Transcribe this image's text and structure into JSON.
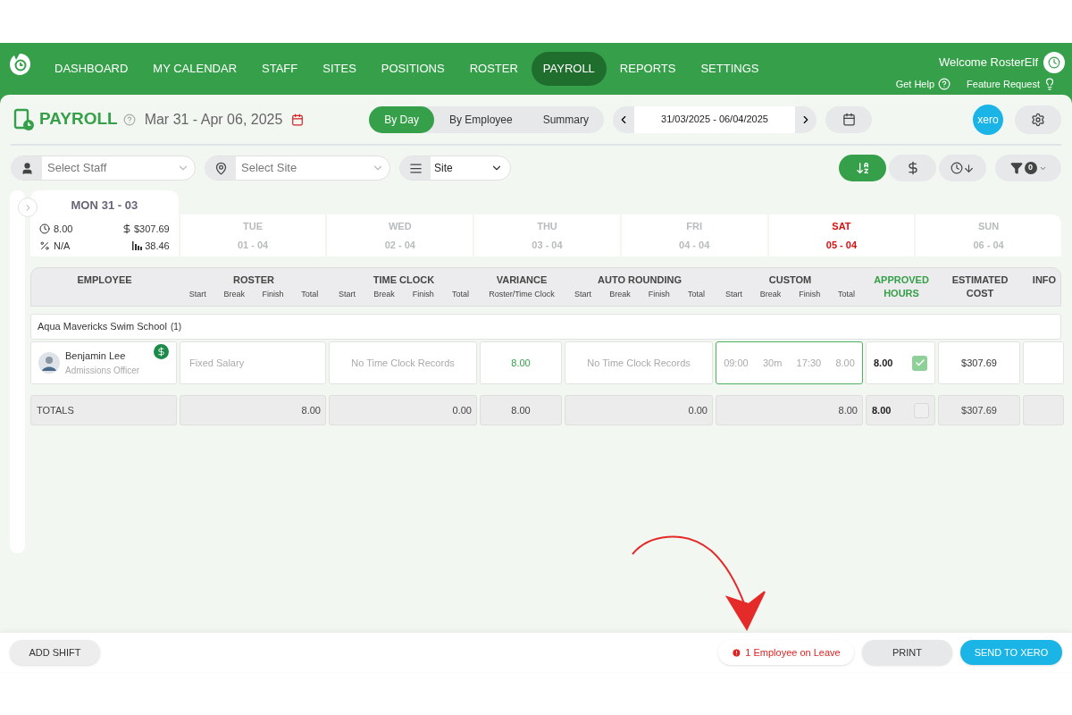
{
  "nav": {
    "items": [
      {
        "label": "DASHBOARD",
        "selected": false
      },
      {
        "label": "MY CALENDAR",
        "selected": false
      },
      {
        "label": "STAFF",
        "selected": false
      },
      {
        "label": "SITES",
        "selected": false
      },
      {
        "label": "POSITIONS",
        "selected": false
      },
      {
        "label": "ROSTER",
        "selected": false
      },
      {
        "label": "PAYROLL",
        "selected": true
      },
      {
        "label": "REPORTS",
        "selected": false
      },
      {
        "label": "SETTINGS",
        "selected": false
      }
    ],
    "welcome": "Welcome RosterElf",
    "get_help": "Get Help",
    "feature_request": "Feature Request"
  },
  "header": {
    "title": "PAYROLL",
    "date_range": "Mar 31 - Apr 06, 2025",
    "view_tabs": [
      {
        "label": "By Day",
        "selected": true
      },
      {
        "label": "By Employee",
        "selected": false
      },
      {
        "label": "Summary",
        "selected": false
      }
    ],
    "range_value": "31/03/2025 - 06/04/2025",
    "xero": "xero"
  },
  "filters": {
    "staff_placeholder": "Select Staff",
    "site_placeholder": "Select Site",
    "group_value": "Site"
  },
  "sort_buttons": [
    {
      "kind": "alpha",
      "selected": true
    },
    {
      "kind": "cost",
      "selected": false
    },
    {
      "kind": "time",
      "selected": false
    }
  ],
  "filter_count": "0",
  "days": [
    {
      "day": "MON",
      "date": "31 - 03",
      "selected": true,
      "highlight": false,
      "hours": "8.00",
      "cost": "$307.69",
      "percent": "N/A",
      "average": "38.46"
    },
    {
      "day": "TUE",
      "date": "01 - 04",
      "selected": false,
      "highlight": false
    },
    {
      "day": "WED",
      "date": "02 - 04",
      "selected": false,
      "highlight": false
    },
    {
      "day": "THU",
      "date": "03 - 04",
      "selected": false,
      "highlight": false
    },
    {
      "day": "FRI",
      "date": "04 - 04",
      "selected": false,
      "highlight": false
    },
    {
      "day": "SAT",
      "date": "05 - 04",
      "selected": false,
      "highlight": true
    },
    {
      "day": "SUN",
      "date": "06 - 04",
      "selected": false,
      "highlight": false
    }
  ],
  "table": {
    "columns": [
      {
        "title": "EMPLOYEE",
        "highlight": false
      },
      {
        "title": "ROSTER",
        "subs": [
          "Start",
          "Break",
          "Finish",
          "Total"
        ],
        "highlight": false
      },
      {
        "title": "TIME CLOCK",
        "subs": [
          "Start",
          "Break",
          "Finish",
          "Total"
        ],
        "highlight": false
      },
      {
        "title": "VARIANCE",
        "subs": [
          "Roster/Time Clock"
        ],
        "highlight": false
      },
      {
        "title": "AUTO ROUNDING",
        "subs": [
          "Start",
          "Break",
          "Finish",
          "Total"
        ],
        "highlight": false
      },
      {
        "title": "CUSTOM",
        "subs": [
          "Start",
          "Break",
          "Finish",
          "Total"
        ],
        "highlight": false
      },
      {
        "title": "APPROVED HOURS",
        "highlight": true
      },
      {
        "title": "ESTIMATED COST",
        "highlight": false
      },
      {
        "title": "INFO",
        "highlight": false
      }
    ],
    "group": {
      "name": "Aqua Mavericks Swim School",
      "count": "(1)"
    },
    "rows": [
      {
        "name": "Benjamin Lee",
        "role": "Admissions Officer",
        "roster": "Fixed Salary",
        "time_clock": "No Time Clock Records",
        "variance": "8.00",
        "auto_rounding": "No Time Clock Records",
        "custom": [
          "09:00",
          "30m",
          "17:30",
          "8.00"
        ],
        "approved_hours": "8.00",
        "approved": true,
        "cost": "$307.69"
      }
    ],
    "totals": {
      "label": "TOTALS",
      "roster": "8.00",
      "time_clock": "0.00",
      "variance": "8.00",
      "auto_rounding": "0.00",
      "custom": "8.00",
      "approved_hours": "8.00",
      "approved": false,
      "cost": "$307.69"
    }
  },
  "footer": {
    "add_shift": "ADD SHIFT",
    "leave_notice": "1 Employee on Leave",
    "print": "PRINT",
    "send": "SEND TO XERO"
  }
}
